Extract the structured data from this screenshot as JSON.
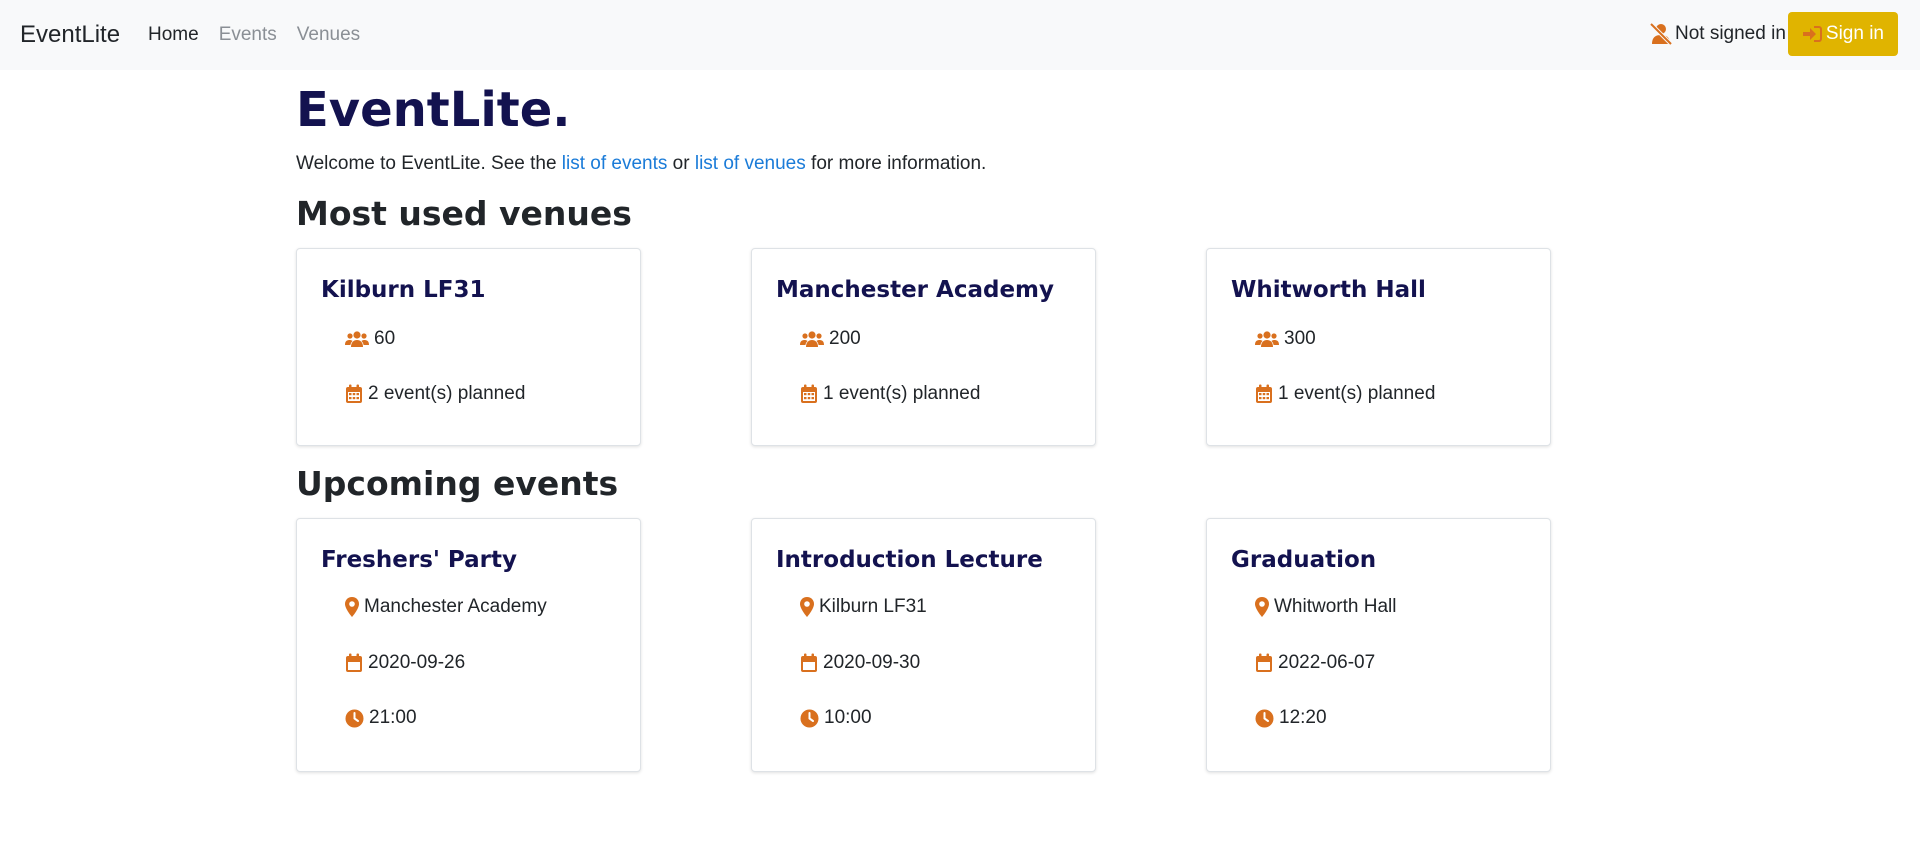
{
  "navbar": {
    "brand": "EventLite",
    "links": [
      {
        "label": "Home",
        "active": true
      },
      {
        "label": "Events",
        "active": false
      },
      {
        "label": "Venues",
        "active": false
      }
    ],
    "status": "Not signed in",
    "signin_label": "Sign in"
  },
  "main": {
    "title": "EventLite.",
    "welcome": {
      "prefix": "Welcome to EventLite. See the ",
      "events_link": "list of events",
      "middle": " or ",
      "venues_link": "list of venues",
      "suffix": " for more information."
    },
    "venues_heading": "Most used venues",
    "venues": [
      {
        "name": "Kilburn LF31",
        "capacity": "60",
        "planned": "2 event(s) planned"
      },
      {
        "name": "Manchester Academy",
        "capacity": "200",
        "planned": "1 event(s) planned"
      },
      {
        "name": "Whitworth Hall",
        "capacity": "300",
        "planned": "1 event(s) planned"
      }
    ],
    "events_heading": "Upcoming events",
    "events": [
      {
        "name": "Freshers' Party",
        "venue": "Manchester Academy",
        "date": "2020-09-26",
        "time": "21:00"
      },
      {
        "name": "Introduction Lecture",
        "venue": "Kilburn LF31",
        "date": "2020-09-30",
        "time": "10:00"
      },
      {
        "name": "Graduation",
        "venue": "Whitworth Hall",
        "date": "2022-06-07",
        "time": "12:20"
      }
    ]
  },
  "colors": {
    "accent_icon": "#d9701e",
    "title": "#13124f",
    "link": "#1a7bd8",
    "signin_bg": "#e0b400"
  },
  "icons": {
    "status": "user-slash-icon",
    "signin": "sign-in-icon",
    "capacity": "users-icon",
    "planned": "calendar-icon",
    "venue": "map-marker-icon",
    "date": "calendar-alt-icon",
    "time": "clock-icon"
  }
}
